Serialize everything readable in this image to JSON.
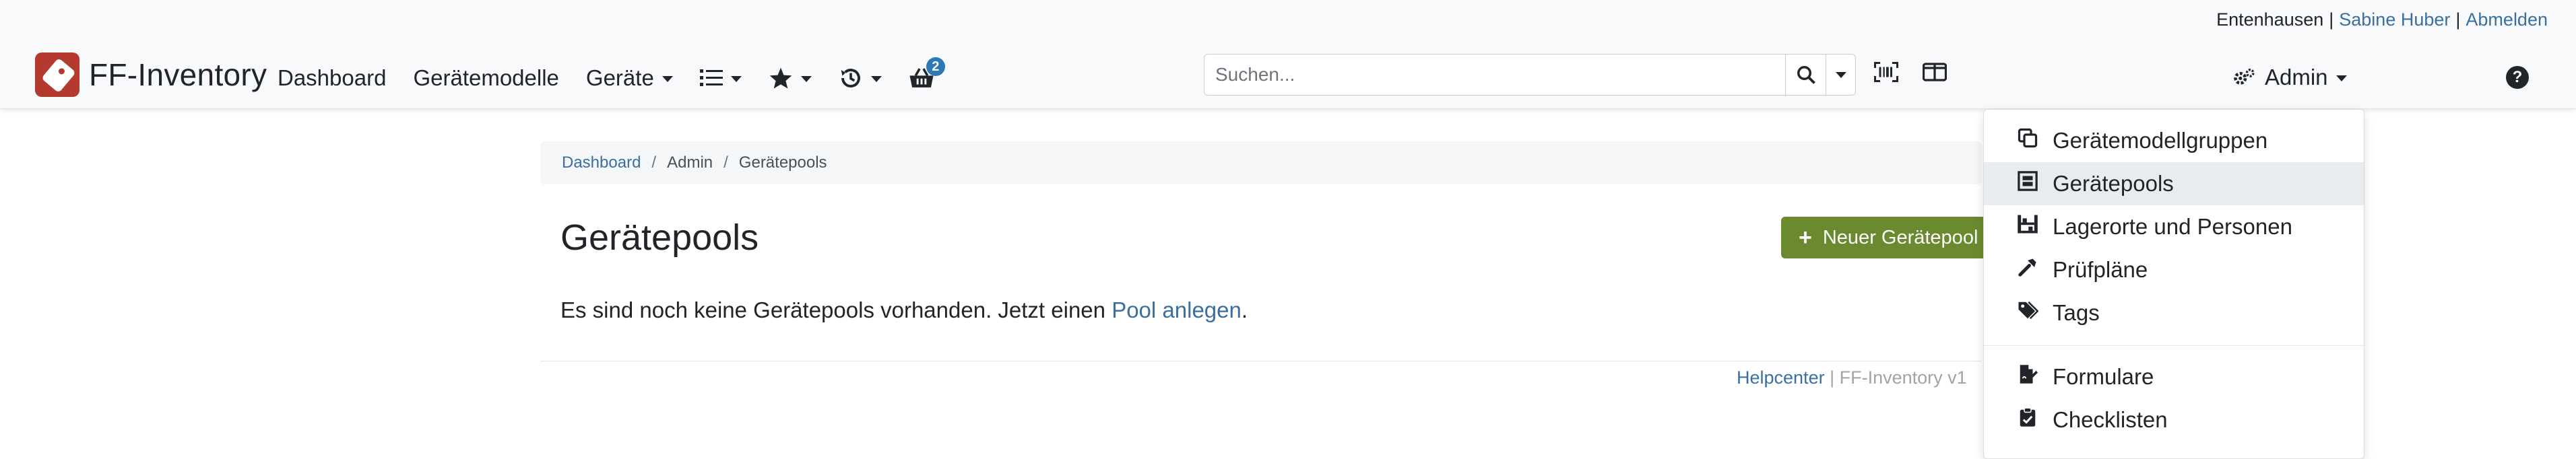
{
  "userbar": {
    "location": "Entenhausen",
    "user": "Sabine Huber",
    "logout": "Abmelden",
    "separator": "|"
  },
  "brand": {
    "name": "FF-Inventory"
  },
  "nav": {
    "dashboard": "Dashboard",
    "models": "Gerätemodelle",
    "devices": "Geräte",
    "basket_count": "2"
  },
  "search": {
    "placeholder": "Suchen..."
  },
  "admin": {
    "label": "Admin"
  },
  "help": {
    "label": "?"
  },
  "breadcrumb": {
    "items": [
      "Dashboard",
      "Admin",
      "Gerätepools"
    ],
    "separator": "/"
  },
  "page": {
    "title": "Gerätepools",
    "new_button": "Neuer Gerätepool",
    "empty_prefix": "Es sind noch keine Gerätepools vorhanden. Jetzt einen ",
    "empty_link": "Pool anlegen",
    "empty_suffix": "."
  },
  "footer": {
    "help": "Helpcenter",
    "separator": " | ",
    "version": "FF-Inventory v1"
  },
  "admin_menu": {
    "items": [
      {
        "label": "Gerätemodellgruppen",
        "icon": "clone-icon"
      },
      {
        "label": "Gerätepools",
        "icon": "pool-icon",
        "active": true
      },
      {
        "label": "Lagerorte und Personen",
        "icon": "warehouse-icon"
      },
      {
        "label": "Prüfpläne",
        "icon": "hammer-icon"
      },
      {
        "label": "Tags",
        "icon": "tags-icon"
      },
      {
        "label": "Formulare",
        "icon": "file-signature-icon"
      },
      {
        "label": "Checklisten",
        "icon": "clipboard-check-icon"
      }
    ]
  },
  "colors": {
    "accent_link": "#3a6fa0",
    "brand": "#b43a2f",
    "success_button": "#6b8a2f",
    "badge": "#2d78b8"
  }
}
